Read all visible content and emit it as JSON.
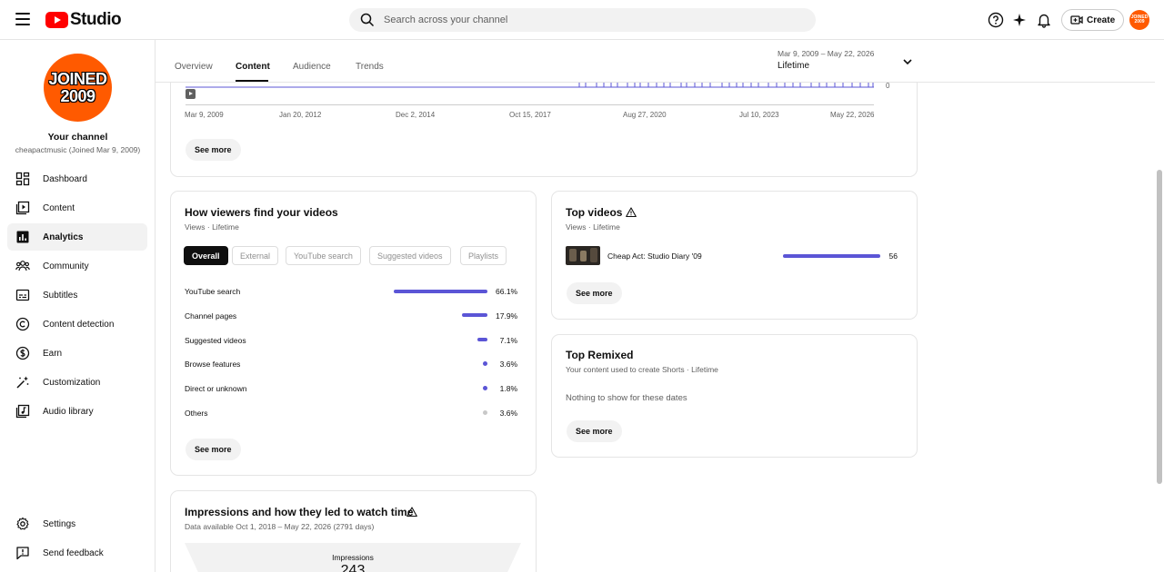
{
  "header": {
    "logo_text": "Studio",
    "search_placeholder": "Search across your channel",
    "create_label": "Create",
    "avatar_text": "JOINED 2009"
  },
  "sidebar": {
    "avatar_text_line1": "JOINED",
    "avatar_text_line2": "2009",
    "channel_label": "Your channel",
    "channel_sub": "cheapactmusic (Joined Mar 9, 2009)",
    "items": [
      {
        "label": "Dashboard",
        "icon": "dashboard-icon"
      },
      {
        "label": "Content",
        "icon": "content-icon"
      },
      {
        "label": "Analytics",
        "icon": "analytics-icon",
        "active": true
      },
      {
        "label": "Community",
        "icon": "community-icon"
      },
      {
        "label": "Subtitles",
        "icon": "subtitles-icon"
      },
      {
        "label": "Content detection",
        "icon": "copyright-icon"
      },
      {
        "label": "Earn",
        "icon": "dollar-icon"
      },
      {
        "label": "Customization",
        "icon": "magic-wand-icon"
      },
      {
        "label": "Audio library",
        "icon": "audio-library-icon"
      }
    ],
    "settings_label": "Settings",
    "feedback_label": "Send feedback"
  },
  "tabs": {
    "items": [
      "Overview",
      "Content",
      "Audience",
      "Trends"
    ],
    "active": "Content",
    "date_range": "Mar 9, 2009 – May 22, 2026",
    "date_range_label": "Lifetime"
  },
  "timeline_card": {
    "zero_label": "0",
    "dates": [
      "Mar 9, 2009",
      "Jan 20, 2012",
      "Dec 2, 2014",
      "Oct 15, 2017",
      "Aug 27, 2020",
      "Jul 10, 2023",
      "May 22, 2026"
    ],
    "see_more": "See more"
  },
  "viewers_card": {
    "title": "How viewers find your videos",
    "subtitle": "Views · Lifetime",
    "chips": [
      "Overall",
      "External",
      "YouTube search",
      "Suggested videos",
      "Playlists"
    ],
    "rows": [
      {
        "label": "YouTube search",
        "value": "66.1%",
        "share": 66.1
      },
      {
        "label": "Channel pages",
        "value": "17.9%",
        "share": 17.9
      },
      {
        "label": "Suggested videos",
        "value": "7.1%",
        "share": 7.1
      },
      {
        "label": "Browse features",
        "value": "3.6%",
        "share": 3.6
      },
      {
        "label": "Direct or unknown",
        "value": "1.8%",
        "share": 1.8
      },
      {
        "label": "Others",
        "value": "3.6%",
        "share": 3.6
      }
    ],
    "see_more": "See more"
  },
  "top_videos_card": {
    "title": "Top videos",
    "subtitle": "Views · Lifetime",
    "video_title": "Cheap Act: Studio Diary '09",
    "video_views": "56",
    "see_more": "See more"
  },
  "top_remixed_card": {
    "title": "Top Remixed",
    "subtitle": "Your content used to create Shorts · Lifetime",
    "empty_text": "Nothing to show for these dates",
    "see_more": "See more"
  },
  "impressions_card": {
    "title": "Impressions and how they led to watch time",
    "subtitle": "Data available Oct 1, 2018 – May 22, 2026 (2791 days)",
    "impressions_label": "Impressions",
    "impressions_value": "243"
  },
  "colors": {
    "accent_bar": "#5b55d6",
    "brand_red": "#ff0000",
    "avatar_orange": "#ff5a00"
  }
}
